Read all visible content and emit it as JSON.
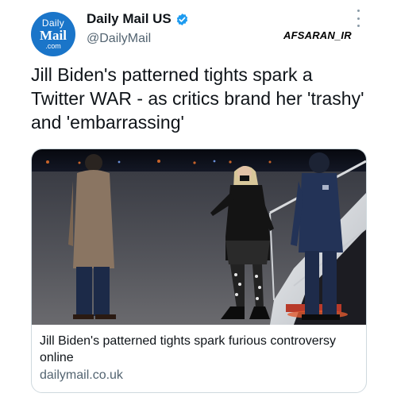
{
  "account": {
    "display_name": "Daily Mail US",
    "handle": "@DailyMail",
    "avatar_lines": [
      "Daily",
      "Mail",
      ".com"
    ],
    "verified": true
  },
  "watermark": "AFSARAN_IR",
  "tweet": {
    "text": "Jill Biden's patterned tights spark a Twitter WAR - as critics brand her 'trashy' and 'embarrassing'"
  },
  "card": {
    "image": "photo-airport-tarmac",
    "title": "Jill Biden's patterned tights spark furious controversy online",
    "domain": "dailymail.co.uk"
  },
  "icons": {
    "verified": "verified-badge-icon",
    "more": "more-options-icon"
  },
  "colors": {
    "brand": "#1a75c9",
    "verified": "#1d9bf0",
    "secondary_text": "#536471",
    "border": "#cfd9de"
  }
}
